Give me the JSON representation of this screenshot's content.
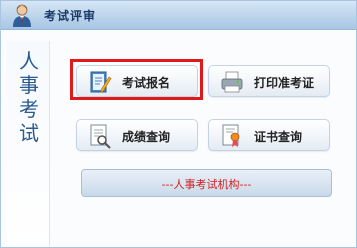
{
  "header": {
    "title": "考试评审",
    "avatar_icon": "user-avatar-icon"
  },
  "side_label": "人事考试",
  "buttons": {
    "register": {
      "label": "考试报名",
      "icon": "form-pencil-icon"
    },
    "print_ticket": {
      "label": "打印准考证",
      "icon": "printer-icon"
    },
    "score_query": {
      "label": "成绩查询",
      "icon": "document-search-icon"
    },
    "certificate_query": {
      "label": "证书查询",
      "icon": "certificate-search-icon"
    }
  },
  "org_link": {
    "label": "---人事考试机构---"
  },
  "colors": {
    "highlight_border": "#e01a1a",
    "title_text": "#1a3a66",
    "org_text": "#d02020",
    "side_text": "#2a5a90"
  }
}
